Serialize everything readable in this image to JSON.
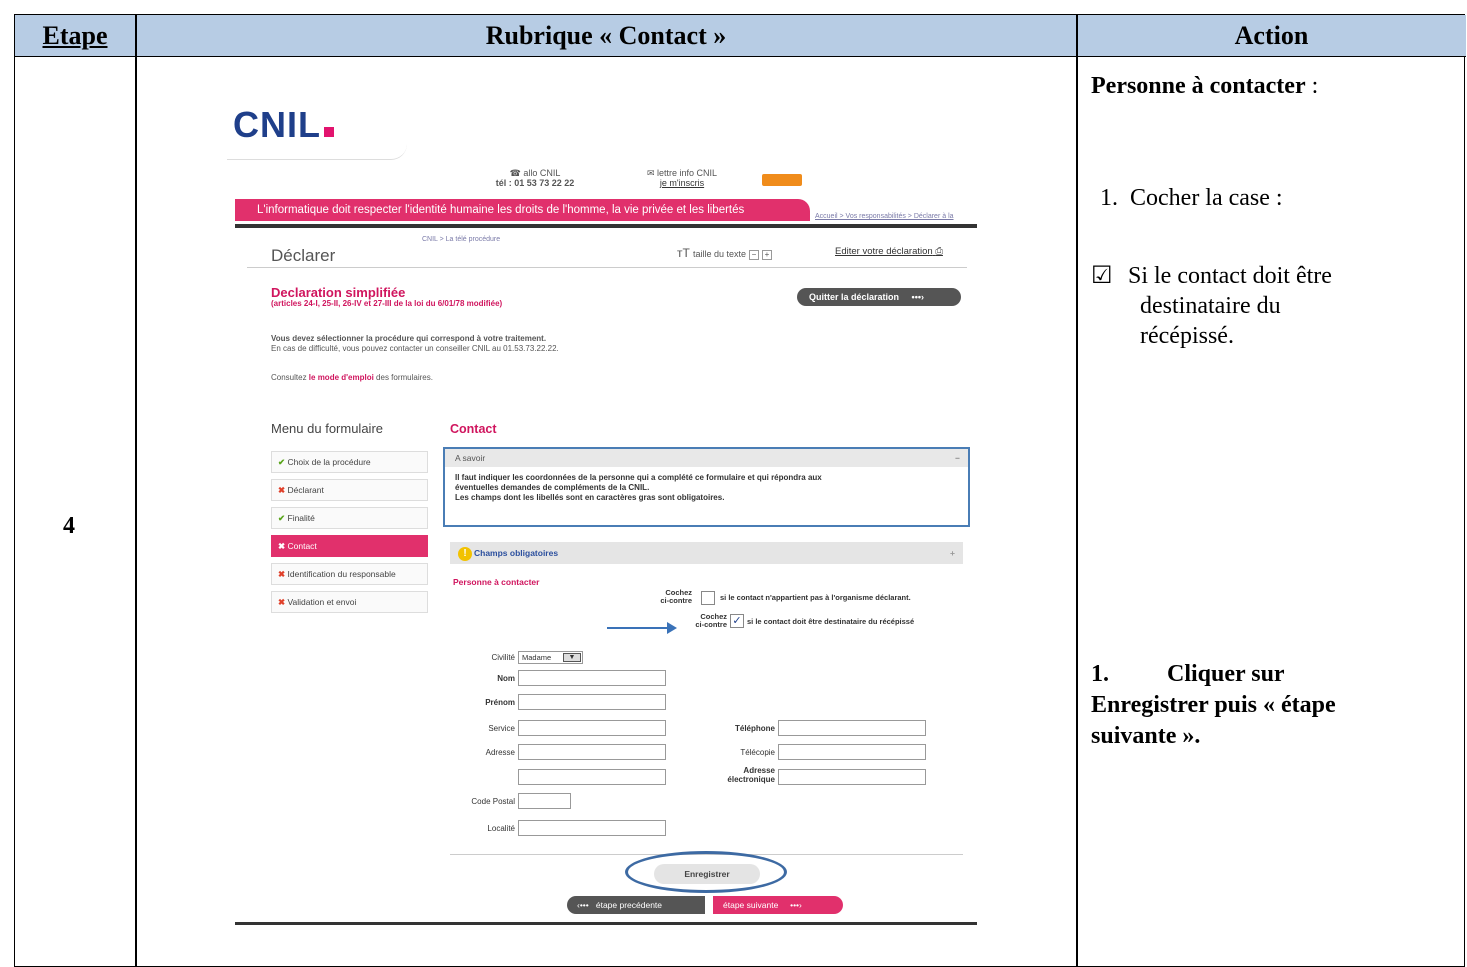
{
  "table": {
    "headers": {
      "etape": "Etape",
      "rubrique": "Rubrique « Contact »",
      "action": "Action"
    },
    "step_number": "4"
  },
  "action": {
    "title": "Personne à contacter",
    "title_suffix": " :",
    "item1_num": "1.",
    "item1_text": "Cocher la case :",
    "check_symbol": "☑",
    "check_line1": "Si le contact doit être",
    "check_line2": "destinataire du",
    "check_line3": "récépissé.",
    "item2_num": "1.",
    "item2_line1": "Cliquer sur",
    "item2_line2": "Enregistrer puis « étape",
    "item2_line3": "suivante »."
  },
  "screenshot": {
    "logo": "CNIL",
    "allo_label": "allo CNIL",
    "allo_phone": "tél : 01 53 73 22 22",
    "lettre_label": "lettre info CNIL",
    "lettre_link": "je m'inscris",
    "banner": "L'informatique doit respecter l'identité humaine les droits de l'homme, la vie privée et les libertés",
    "top_crumbs": "Accueil > Vos responsabilités > Déclarer à la",
    "page_title": "Déclarer",
    "crumbs": "CNIL > La télé procédure",
    "taille_label": "taille du texte",
    "edit_link": "Editer votre déclaration",
    "decl_title": "Declaration simplifiée",
    "decl_sub": "(articles 24-I, 25-II, 26-IV et 27-III de la loi du 6/01/78 modifiée)",
    "quit_button": "Quitter la déclaration",
    "intro_line1": "Vous devez sélectionner la procédure qui correspond à votre traitement.",
    "intro_line2": "En cas de difficulté, vous pouvez contacter un conseiller CNIL au 01.53.73.22.22.",
    "consult_prefix": "Consultez ",
    "consult_link": "le mode d'emploi",
    "consult_suffix": " des formulaires.",
    "menu_title": "Menu du formulaire",
    "menu": [
      {
        "label": "Choix de la procédure",
        "status": "ok"
      },
      {
        "label": "Déclarant",
        "status": "ko"
      },
      {
        "label": "Finalité",
        "status": "ok"
      },
      {
        "label": "Contact",
        "status": "ko"
      },
      {
        "label": "Identification du responsable",
        "status": "ko"
      },
      {
        "label": "Validation et envoi",
        "status": "ko"
      }
    ],
    "contact_title": "Contact",
    "savoir_title": "A savoir",
    "savoir_line1": "Il faut indiquer les coordonnées de la personne qui a complété ce formulaire et qui répondra aux",
    "savoir_line2": "éventuelles demandes de compléments de la CNIL.",
    "savoir_line3": "Les champs dont les libellés sont en caractères gras sont obligatoires.",
    "oblig_label": "Champs obligatoires",
    "personne_label": "Personne à contacter",
    "cochez1_a": "Cochez",
    "cochez1_b": "ci-contre",
    "cochez1_text": "si le contact n'appartient pas à l'organisme déclarant.",
    "cochez2_a": "Cochez",
    "cochez2_b": "ci-contre",
    "cochez2_text": "si le contact doit être destinataire du récépissé",
    "civilite_label": "Civilité",
    "civilite_value": "Madame",
    "nom_label": "Nom",
    "prenom_label": "Prénom",
    "service_label": "Service",
    "adresse_label": "Adresse",
    "code_postal_label": "Code Postal",
    "localite_label": "Localité",
    "telephone_label": "Téléphone",
    "telecopie_label": "Télécopie",
    "email_label_1": "Adresse",
    "email_label_2": "électronique",
    "save_button": "Enregistrer",
    "prev_button": "étape precédente",
    "next_button": "étape suivante"
  },
  "colors": {
    "header_bg": "#b7cce4",
    "cnil_pink": "#e1306c",
    "cnil_blue": "#1f3f8a",
    "highlight_blue": "#4a7db5"
  }
}
